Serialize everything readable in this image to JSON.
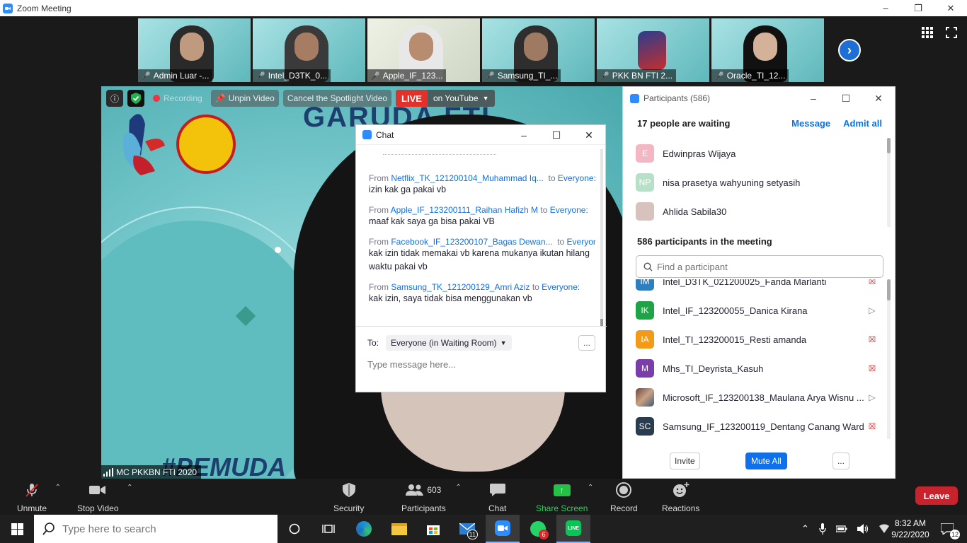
{
  "window": {
    "title": "Zoom Meeting"
  },
  "thumbnails": [
    {
      "label": "Admin Luar -..."
    },
    {
      "label": "Intel_D3TK_0..."
    },
    {
      "label": "Apple_IF_123..."
    },
    {
      "label": "Samsung_TI_..."
    },
    {
      "label": "PKK BN FTI 2..."
    },
    {
      "label": "Oracle_TI_12..."
    }
  ],
  "main_video": {
    "recording": "Recording",
    "unpin": "Unpin Video",
    "cancel_spotlight": "Cancel the Spotlight Video",
    "live": "LIVE",
    "youtube": "on YouTube",
    "speaker": "MC PKKBN FTI 2020",
    "bg_text_top": "GARUDA FTI",
    "bg_text_bottom": "#PEMUDA"
  },
  "chat": {
    "title": "Chat",
    "messages": [
      {
        "from": "Netflix_TK_121200104_Muhammad Iq...",
        "to": "Everyone:",
        "text": "izin kak ga pakai vb"
      },
      {
        "from": "Apple_IF_123200111_Raihan Hafizh M",
        "to": "Everyone:",
        "text": "maaf kak saya ga bisa pakai VB"
      },
      {
        "from": "Facebook_IF_123200107_Bagas Dewan...",
        "to": "Everyone:",
        "text": "kak izin tidak memakai vb karena mukanya ikutan hilang waktu pakai vb"
      },
      {
        "from": "Samsung_TK_121200129_Amri Aziz",
        "to": "Everyone:",
        "text": "kak izin, saya tidak bisa menggunakan vb"
      }
    ],
    "from_word": "From",
    "to_word": "to",
    "to_label": "To:",
    "recipient": "Everyone (in Waiting Room)",
    "more": "...",
    "placeholder": "Type message here..."
  },
  "participants": {
    "title": "Participants (586)",
    "waiting_text": "17 people are waiting",
    "message_btn": "Message",
    "admit_all_btn": "Admit all",
    "waiting": [
      {
        "name": "Edwinpras Wijaya",
        "initials": "E",
        "color": "#f4b6c2"
      },
      {
        "name": "nisa prasetya wahyuning setyasih",
        "initials": "NP",
        "color": "#b8e0c8"
      },
      {
        "name": "Ahlida Sabila30",
        "initials": "",
        "color": "#d8c2be"
      }
    ],
    "in_meeting_text": "586 participants in the meeting",
    "search_placeholder": "Find a participant",
    "list": [
      {
        "name": "Intel_D3TK_021200025_Farida Marlanti",
        "initials": "IM",
        "color": "#2d7fc0",
        "status": "muted"
      },
      {
        "name": "Intel_IF_123200055_Danica Kirana",
        "initials": "IK",
        "color": "#1ea446",
        "status": "cam"
      },
      {
        "name": "Intel_TI_123200015_Resti amanda",
        "initials": "IA",
        "color": "#f49a19",
        "status": "muted"
      },
      {
        "name": "Mhs_TI_Deyrista_Kasuh",
        "initials": "M",
        "color": "#7a3ea8",
        "status": "muted"
      },
      {
        "name": "Microsoft_IF_123200138_Maulana Arya Wisnu ...",
        "initials": "",
        "color": "#6b4a3b",
        "status": "cam"
      },
      {
        "name": "Samsung_IF_123200119_Dentang Canang Ward...",
        "initials": "SC",
        "color": "#2a3d4f",
        "status": "muted"
      }
    ],
    "invite_btn": "Invite",
    "mute_all_btn": "Mute All",
    "more_btn": "..."
  },
  "controls": {
    "unmute": "Unmute",
    "stop_video": "Stop Video",
    "security": "Security",
    "participants": "Participants",
    "participants_count": "603",
    "chat": "Chat",
    "share_screen": "Share Screen",
    "record": "Record",
    "reactions": "Reactions",
    "leave": "Leave"
  },
  "taskbar": {
    "search_placeholder": "Type here to search",
    "mail_badge": "11",
    "whatsapp_badge": "6",
    "time": "8:32 AM",
    "date": "9/22/2020",
    "notif_count": "12"
  }
}
